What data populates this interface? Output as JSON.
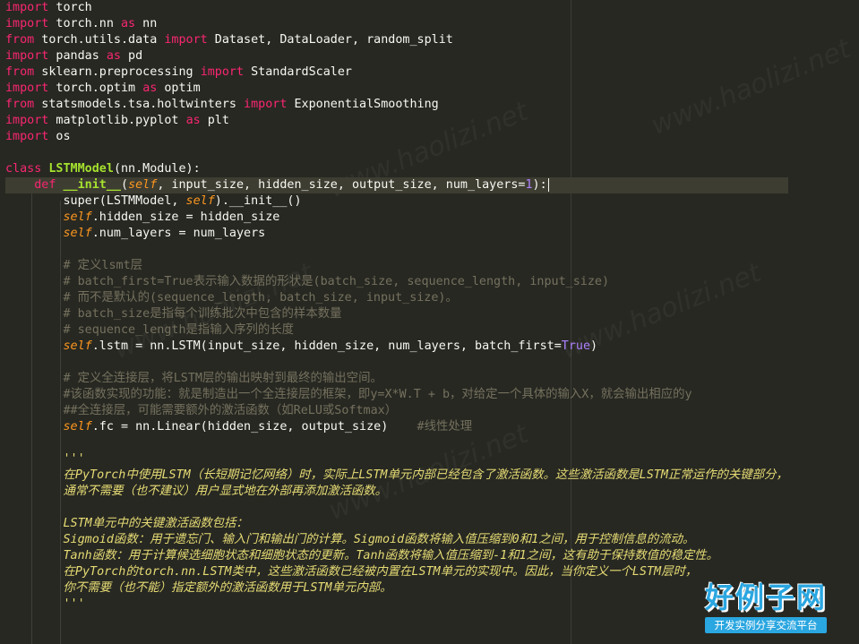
{
  "editor": {
    "lines": [
      [
        {
          "t": "import",
          "c": "kw"
        },
        {
          "t": " torch",
          "c": "pl"
        }
      ],
      [
        {
          "t": "import",
          "c": "kw"
        },
        {
          "t": " torch.nn ",
          "c": "pl"
        },
        {
          "t": "as",
          "c": "kw"
        },
        {
          "t": " nn",
          "c": "pl"
        }
      ],
      [
        {
          "t": "from",
          "c": "kw"
        },
        {
          "t": " torch.utils.data ",
          "c": "pl"
        },
        {
          "t": "import",
          "c": "kw"
        },
        {
          "t": " Dataset, DataLoader, random_split",
          "c": "pl"
        }
      ],
      [
        {
          "t": "import",
          "c": "kw"
        },
        {
          "t": " pandas ",
          "c": "pl"
        },
        {
          "t": "as",
          "c": "kw"
        },
        {
          "t": " pd",
          "c": "pl"
        }
      ],
      [
        {
          "t": "from",
          "c": "kw"
        },
        {
          "t": " sklearn.preprocessing ",
          "c": "pl"
        },
        {
          "t": "import",
          "c": "kw"
        },
        {
          "t": " StandardScaler",
          "c": "pl"
        }
      ],
      [
        {
          "t": "import",
          "c": "kw"
        },
        {
          "t": " torch.optim ",
          "c": "pl"
        },
        {
          "t": "as",
          "c": "kw"
        },
        {
          "t": " optim",
          "c": "pl"
        }
      ],
      [
        {
          "t": "from",
          "c": "kw"
        },
        {
          "t": " statsmodels.tsa.holtwinters ",
          "c": "pl"
        },
        {
          "t": "import",
          "c": "kw"
        },
        {
          "t": " ExponentialSmoothing",
          "c": "pl"
        }
      ],
      [
        {
          "t": "import",
          "c": "kw"
        },
        {
          "t": " matplotlib.pyplot ",
          "c": "pl"
        },
        {
          "t": "as",
          "c": "kw"
        },
        {
          "t": " plt",
          "c": "pl"
        }
      ],
      [
        {
          "t": "import",
          "c": "kw"
        },
        {
          "t": " os",
          "c": "pl"
        }
      ],
      [],
      [
        {
          "t": "class",
          "c": "kw"
        },
        {
          "t": " ",
          "c": "pl"
        },
        {
          "t": "LSTMModel",
          "c": "fn"
        },
        {
          "t": "(nn.Module):",
          "c": "pl"
        }
      ],
      [
        {
          "t": "    ",
          "c": "pl"
        },
        {
          "t": "def",
          "c": "kw"
        },
        {
          "t": " ",
          "c": "pl"
        },
        {
          "t": "__init__",
          "c": "fn"
        },
        {
          "t": "(",
          "c": "pl"
        },
        {
          "t": "self",
          "c": "self"
        },
        {
          "t": ", input_size, hidden_size, output_size, num_layers=",
          "c": "pl"
        },
        {
          "t": "1",
          "c": "num"
        },
        {
          "t": "):",
          "c": "pl"
        }
      ],
      [
        {
          "t": "        super(LSTMModel, ",
          "c": "pl"
        },
        {
          "t": "self",
          "c": "self"
        },
        {
          "t": ").__init__()",
          "c": "pl"
        }
      ],
      [
        {
          "t": "        ",
          "c": "pl"
        },
        {
          "t": "self",
          "c": "self"
        },
        {
          "t": ".hidden_size = hidden_size",
          "c": "pl"
        }
      ],
      [
        {
          "t": "        ",
          "c": "pl"
        },
        {
          "t": "self",
          "c": "self"
        },
        {
          "t": ".num_layers = num_layers",
          "c": "pl"
        }
      ],
      [],
      [
        {
          "t": "        # 定义lsmt层",
          "c": "cm"
        }
      ],
      [
        {
          "t": "        # batch_first=True表示输入数据的形状是(batch_size, sequence_length, input_size)",
          "c": "cm"
        }
      ],
      [
        {
          "t": "        # 而不是默认的(sequence_length, batch_size, input_size)。",
          "c": "cm"
        }
      ],
      [
        {
          "t": "        # batch_size是指每个训练批次中包含的样本数量",
          "c": "cm"
        }
      ],
      [
        {
          "t": "        # sequence_length是指输入序列的长度",
          "c": "cm"
        }
      ],
      [
        {
          "t": "        ",
          "c": "pl"
        },
        {
          "t": "self",
          "c": "self"
        },
        {
          "t": ".lstm = nn.LSTM(input_size, hidden_size, num_layers, batch_first=",
          "c": "pl"
        },
        {
          "t": "True",
          "c": "num"
        },
        {
          "t": ")",
          "c": "pl"
        }
      ],
      [],
      [
        {
          "t": "        # 定义全连接层，将LSTM层的输出映射到最终的输出空间。",
          "c": "cm"
        }
      ],
      [
        {
          "t": "        #该函数实现的功能：就是制造出一个全连接层的框架，即y=X*W.T + b，对给定一个具体的输入X，就会输出相应的y",
          "c": "cm"
        }
      ],
      [
        {
          "t": "        ##全连接层，可能需要额外的激活函数（如ReLU或Softmax）",
          "c": "cm"
        }
      ],
      [
        {
          "t": "        ",
          "c": "pl"
        },
        {
          "t": "self",
          "c": "self"
        },
        {
          "t": ".fc = nn.Linear(hidden_size, output_size)    ",
          "c": "pl"
        },
        {
          "t": "#线性处理",
          "c": "cm"
        }
      ],
      [],
      [
        {
          "t": "        '''",
          "c": "doc"
        }
      ],
      [
        {
          "t": "        在PyTorch中使用LSTM（长短期记忆网络）时，实际上LSTM单元内部已经包含了激活函数。这些激活函数是LSTM正常运作的关键部分，",
          "c": "doc"
        }
      ],
      [
        {
          "t": "        通常不需要（也不建议）用户显式地在外部再添加激活函数。",
          "c": "doc"
        }
      ],
      [],
      [
        {
          "t": "        LSTM单元中的关键激活函数包括：",
          "c": "doc"
        }
      ],
      [
        {
          "t": "        Sigmoid函数：用于遗忘门、输入门和输出门的计算。Sigmoid函数将输入值压缩到0和1之间，用于控制信息的流动。",
          "c": "doc"
        }
      ],
      [
        {
          "t": "        Tanh函数：用于计算候选细胞状态和细胞状态的更新。Tanh函数将输入值压缩到-1和1之间，这有助于保持数值的稳定性。",
          "c": "doc"
        }
      ],
      [
        {
          "t": "        在PyTorch的torch.nn.LSTM类中，这些激活函数已经被内置在LSTM单元的实现中。因此，当你定义一个LSTM层时，",
          "c": "doc"
        }
      ],
      [
        {
          "t": "        你不需要（也不能）指定额外的激活函数用于LSTM单元内部。",
          "c": "doc"
        }
      ],
      [
        {
          "t": "        '''",
          "c": "doc"
        }
      ]
    ]
  },
  "watermark": {
    "text": "www.haolizi.net",
    "logo_title": "好例子网",
    "logo_subtitle": "开发实例分享交流平台"
  },
  "colors": {
    "background": "#272822",
    "keyword": "#f92672",
    "function_name": "#a6e22e",
    "self": "#fd971f",
    "number": "#ae81ff",
    "comment": "#75715e",
    "docstring": "#e6db74",
    "plain": "#f8f8f2"
  }
}
